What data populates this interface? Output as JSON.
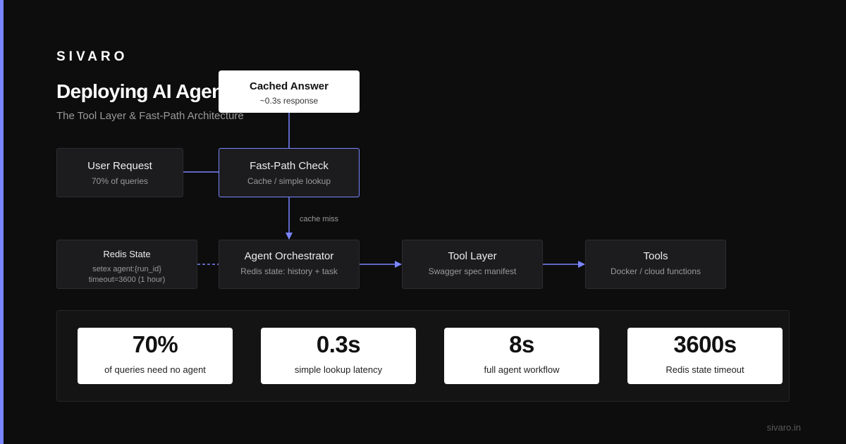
{
  "brand": "SIVARO",
  "title": "Deploying AI Agents",
  "subtitle": "The Tool Layer & Fast-Path Architecture",
  "colors": {
    "accent": "#7a85ff",
    "background": "#0d0d0d",
    "node_fill": "#1c1c1e"
  },
  "nodes": {
    "user_request": {
      "label": "User Request",
      "sub": "70% of queries"
    },
    "fast_path": {
      "label": "Fast-Path Check",
      "sub": "Cache / simple lookup"
    },
    "cached_answer": {
      "label": "Cached Answer",
      "sub": "~0.3s response"
    },
    "redis_state": {
      "label": "Redis State",
      "sub1": "setex agent:{run_id}",
      "sub2": "timeout=3600 (1 hour)"
    },
    "orchestrator": {
      "label": "Agent Orchestrator",
      "sub": "Redis state: history + task"
    },
    "tool_layer": {
      "label": "Tool Layer",
      "sub": "Swagger spec manifest"
    },
    "tools": {
      "label": "Tools",
      "sub": "Docker / cloud functions"
    }
  },
  "edges": {
    "cache_miss_label": "cache miss"
  },
  "stats": [
    {
      "value": "70%",
      "label": "of queries need no agent"
    },
    {
      "value": "0.3s",
      "label": "simple lookup latency"
    },
    {
      "value": "8s",
      "label": "full agent workflow"
    },
    {
      "value": "3600s",
      "label": "Redis state timeout"
    }
  ],
  "footer": "sivaro.in"
}
